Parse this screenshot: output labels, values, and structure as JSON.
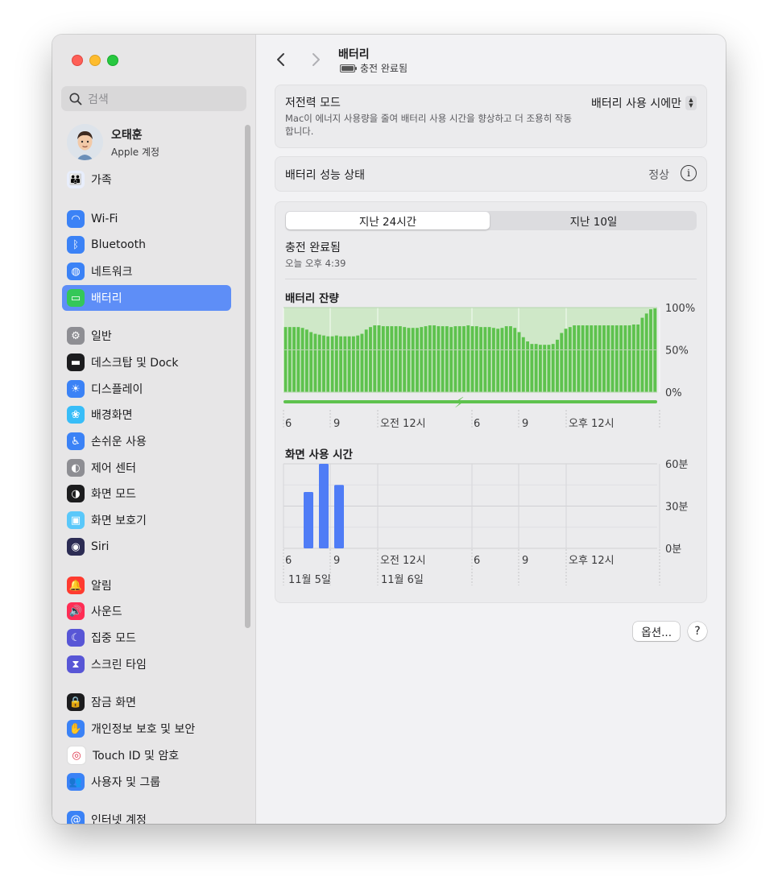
{
  "sidebar": {
    "search_placeholder": "검색",
    "profile": {
      "name": "오태훈",
      "subtitle": "Apple 계정"
    },
    "items": [
      {
        "label": "가족",
        "icon": "family-icon",
        "color": "#e8eefc"
      },
      {
        "label": "Wi-Fi",
        "icon": "wifi-icon",
        "color": "#3b82f6"
      },
      {
        "label": "Bluetooth",
        "icon": "bluetooth-icon",
        "color": "#3b82f6"
      },
      {
        "label": "네트워크",
        "icon": "globe-icon",
        "color": "#3b82f6"
      },
      {
        "label": "배터리",
        "icon": "battery-icon",
        "color": "#34c759",
        "active": true
      },
      {
        "label": "일반",
        "icon": "gear-icon",
        "color": "#8e8e93"
      },
      {
        "label": "데스크탑 및 Dock",
        "icon": "dock-icon",
        "color": "#1c1c1e"
      },
      {
        "label": "디스플레이",
        "icon": "display-icon",
        "color": "#3b82f6"
      },
      {
        "label": "배경화면",
        "icon": "wallpaper-icon",
        "color": "#38bdf8"
      },
      {
        "label": "손쉬운 사용",
        "icon": "accessibility-icon",
        "color": "#3b82f6"
      },
      {
        "label": "제어 센터",
        "icon": "control-center-icon",
        "color": "#8e8e93"
      },
      {
        "label": "화면 모드",
        "icon": "appearance-icon",
        "color": "#1c1c1e"
      },
      {
        "label": "화면 보호기",
        "icon": "screensaver-icon",
        "color": "#5ac8fa"
      },
      {
        "label": "Siri",
        "icon": "siri-icon",
        "color": "#2c2c54"
      },
      {
        "label": "알림",
        "icon": "notifications-icon",
        "color": "#ff3b30"
      },
      {
        "label": "사운드",
        "icon": "sound-icon",
        "color": "#ff2d55"
      },
      {
        "label": "집중 모드",
        "icon": "focus-icon",
        "color": "#5856d6"
      },
      {
        "label": "스크린 타임",
        "icon": "screen-time-icon",
        "color": "#5856d6"
      },
      {
        "label": "잠금 화면",
        "icon": "lock-icon",
        "color": "#1c1c1e"
      },
      {
        "label": "개인정보 보호 및 보안",
        "icon": "privacy-hand-icon",
        "color": "#3b82f6"
      },
      {
        "label": "Touch ID 및 암호",
        "icon": "fingerprint-icon",
        "color": "#ffffff"
      },
      {
        "label": "사용자 및 그룹",
        "icon": "users-icon",
        "color": "#3b82f6"
      },
      {
        "label": "인터넷 계정",
        "icon": "at-icon",
        "color": "#3b82f6"
      }
    ]
  },
  "header": {
    "title": "배터리",
    "subtitle": "충전 완료됨"
  },
  "low_power": {
    "title": "저전력 모드",
    "description": "Mac이 에너지 사용량을 줄여 배터리 사용 시간을 향상하고 더 조용히 작동합니다.",
    "value": "배터리 사용 시에만"
  },
  "health": {
    "label": "배터리 성능 상태",
    "value": "정상"
  },
  "tabs": {
    "last24": "지난 24시간",
    "last10": "지난 10일"
  },
  "status": {
    "title": "충전 완료됨",
    "time": "오늘 오후 4:39"
  },
  "labels": {
    "battery_level": "배터리 잔량",
    "screen_time": "화면 사용 시간",
    "x_ticks": [
      "6",
      "9",
      "오전 12시",
      "6",
      "9",
      "오후 12시"
    ],
    "dates": [
      "11월 5일",
      "11월 6일"
    ]
  },
  "chart_data": [
    {
      "type": "bar",
      "title": "배터리 잔량",
      "y_ticks": [
        "100%",
        "50%",
        "0%"
      ],
      "ylim": [
        0,
        100
      ],
      "x_ticks": [
        "6",
        "9",
        "오전 12시",
        "6",
        "9",
        "오후 12시"
      ],
      "values": [
        77,
        77,
        77,
        77,
        76,
        74,
        71,
        69,
        68,
        67,
        66,
        66,
        67,
        66,
        66,
        66,
        66,
        67,
        69,
        74,
        77,
        79,
        79,
        78,
        78,
        78,
        78,
        78,
        77,
        76,
        76,
        76,
        77,
        78,
        79,
        79,
        78,
        78,
        78,
        77,
        78,
        78,
        78,
        79,
        78,
        78,
        77,
        77,
        77,
        76,
        75,
        76,
        78,
        78,
        76,
        71,
        65,
        60,
        57,
        57,
        56,
        56,
        56,
        57,
        62,
        70,
        75,
        77,
        79,
        79,
        79,
        79,
        79,
        79,
        79,
        79,
        79,
        79,
        79,
        79,
        79,
        79,
        80,
        80,
        88,
        93,
        98,
        99
      ],
      "charging_indicator": "lightning-icon"
    },
    {
      "type": "bar",
      "title": "화면 사용 시간",
      "y_ticks": [
        "60분",
        "30분",
        "0분"
      ],
      "ylim": [
        0,
        60
      ],
      "x_ticks": [
        "6",
        "9",
        "오전 12시",
        "6",
        "9",
        "오후 12시"
      ],
      "categories": [
        "6",
        "7",
        "8"
      ],
      "values": [
        40,
        60,
        45
      ],
      "dates": [
        "11월 5일",
        "11월 6일"
      ],
      "bar_color": "#4f7cf6"
    }
  ],
  "buttons": {
    "options": "옵션...",
    "help": "?"
  },
  "colors": {
    "accent": "#5e8ef7",
    "battery_green": "#5ec24e",
    "battery_bg": "#cfe8c8"
  }
}
